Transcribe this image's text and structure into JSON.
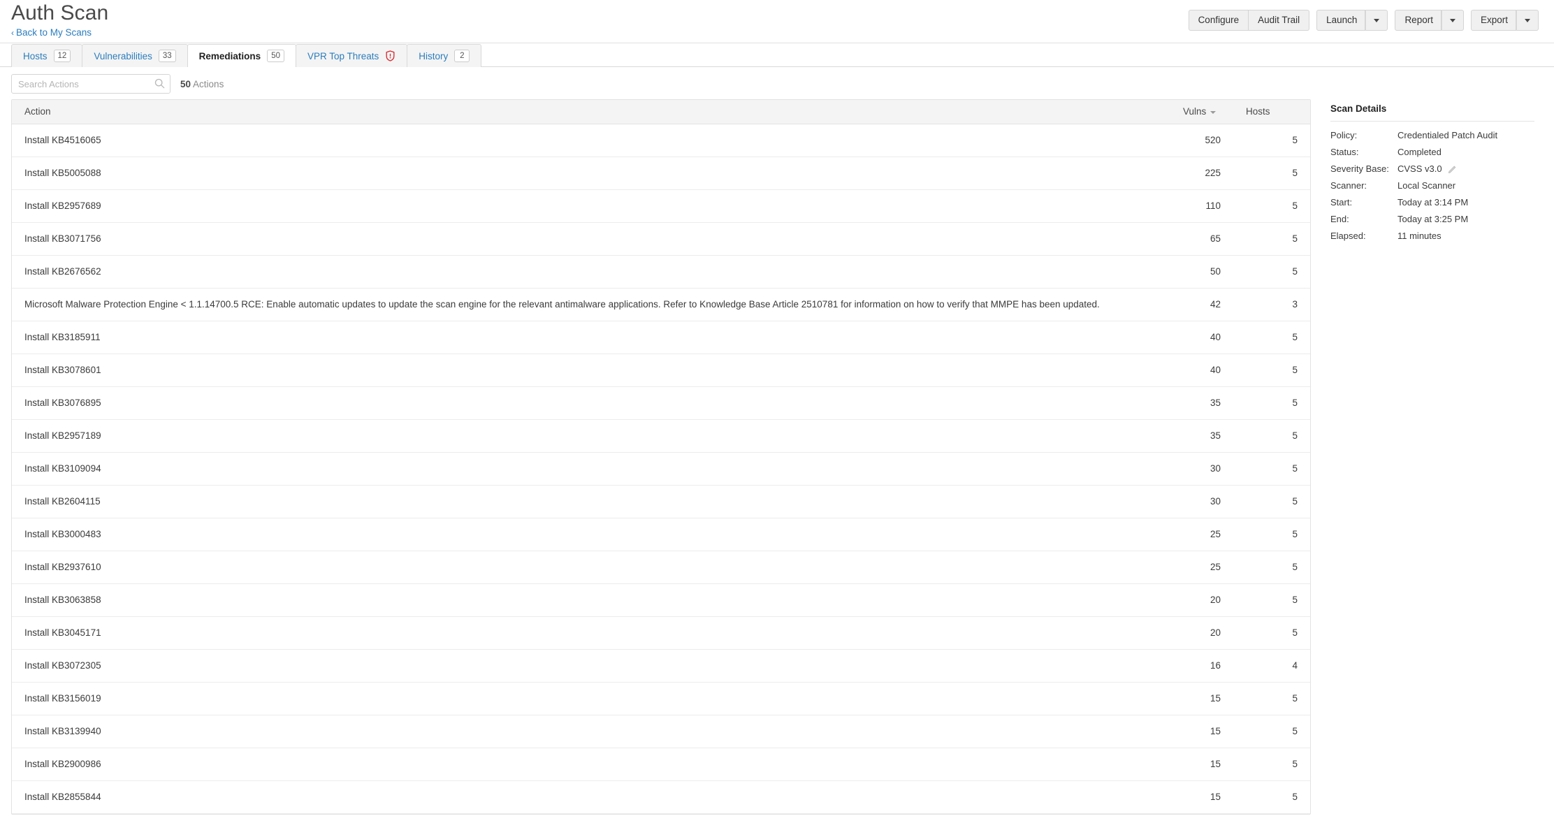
{
  "header": {
    "scan_title": "Auth Scan",
    "back_link": "Back to My Scans",
    "back_chevron": "‹",
    "buttons": {
      "configure": "Configure",
      "audit_trail": "Audit Trail",
      "launch": "Launch",
      "report": "Report",
      "export": "Export"
    }
  },
  "tabs": [
    {
      "label": "Hosts",
      "badge": "12",
      "active": false,
      "icon": ""
    },
    {
      "label": "Vulnerabilities",
      "badge": "33",
      "active": false,
      "icon": ""
    },
    {
      "label": "Remediations",
      "badge": "50",
      "active": true,
      "icon": ""
    },
    {
      "label": "VPR Top Threats",
      "badge": "",
      "active": false,
      "icon": "shield-icon"
    },
    {
      "label": "History",
      "badge": "2",
      "active": false,
      "icon": ""
    }
  ],
  "toolbar": {
    "search_placeholder": "Search Actions",
    "search_value": "",
    "search_icon": "search-icon",
    "count_number": "50",
    "count_word": "Actions"
  },
  "table": {
    "columns": {
      "action": "Action",
      "vulns": "Vulns",
      "hosts": "Hosts"
    },
    "sort_column": "Vulns",
    "sort_direction": "desc",
    "rows": [
      {
        "action": "Install KB4516065",
        "vulns": "520",
        "hosts": "5"
      },
      {
        "action": "Install KB5005088",
        "vulns": "225",
        "hosts": "5"
      },
      {
        "action": "Install KB2957689",
        "vulns": "110",
        "hosts": "5"
      },
      {
        "action": "Install KB3071756",
        "vulns": "65",
        "hosts": "5"
      },
      {
        "action": "Install KB2676562",
        "vulns": "50",
        "hosts": "5"
      },
      {
        "action": "Microsoft Malware Protection Engine < 1.1.14700.5 RCE: Enable automatic updates to update the scan engine for the relevant antimalware applications. Refer to Knowledge Base Article 2510781 for information on how to verify that MMPE has been updated.",
        "vulns": "42",
        "hosts": "3"
      },
      {
        "action": "Install KB3185911",
        "vulns": "40",
        "hosts": "5"
      },
      {
        "action": "Install KB3078601",
        "vulns": "40",
        "hosts": "5"
      },
      {
        "action": "Install KB3076895",
        "vulns": "35",
        "hosts": "5"
      },
      {
        "action": "Install KB2957189",
        "vulns": "35",
        "hosts": "5"
      },
      {
        "action": "Install KB3109094",
        "vulns": "30",
        "hosts": "5"
      },
      {
        "action": "Install KB2604115",
        "vulns": "30",
        "hosts": "5"
      },
      {
        "action": "Install KB3000483",
        "vulns": "25",
        "hosts": "5"
      },
      {
        "action": "Install KB2937610",
        "vulns": "25",
        "hosts": "5"
      },
      {
        "action": "Install KB3063858",
        "vulns": "20",
        "hosts": "5"
      },
      {
        "action": "Install KB3045171",
        "vulns": "20",
        "hosts": "5"
      },
      {
        "action": "Install KB3072305",
        "vulns": "16",
        "hosts": "4"
      },
      {
        "action": "Install KB3156019",
        "vulns": "15",
        "hosts": "5"
      },
      {
        "action": "Install KB3139940",
        "vulns": "15",
        "hosts": "5"
      },
      {
        "action": "Install KB2900986",
        "vulns": "15",
        "hosts": "5"
      },
      {
        "action": "Install KB2855844",
        "vulns": "15",
        "hosts": "5"
      }
    ]
  },
  "scan_details": {
    "title": "Scan Details",
    "fields": [
      {
        "key": "Policy:",
        "value": "Credentialed Patch Audit",
        "edit": false
      },
      {
        "key": "Status:",
        "value": "Completed",
        "edit": false
      },
      {
        "key": "Severity Base:",
        "value": "CVSS v3.0",
        "edit": true
      },
      {
        "key": "Scanner:",
        "value": "Local Scanner",
        "edit": false
      },
      {
        "key": "Start:",
        "value": "Today at 3:14 PM",
        "edit": false
      },
      {
        "key": "End:",
        "value": "Today at 3:25 PM",
        "edit": false
      },
      {
        "key": "Elapsed:",
        "value": "11 minutes",
        "edit": false
      }
    ]
  },
  "colors": {
    "link_blue": "#2b7dbd",
    "shield_red": "#d8282f",
    "tab_inactive_bg": "#f4f4f4",
    "header_bg": "#f4f4f4"
  }
}
